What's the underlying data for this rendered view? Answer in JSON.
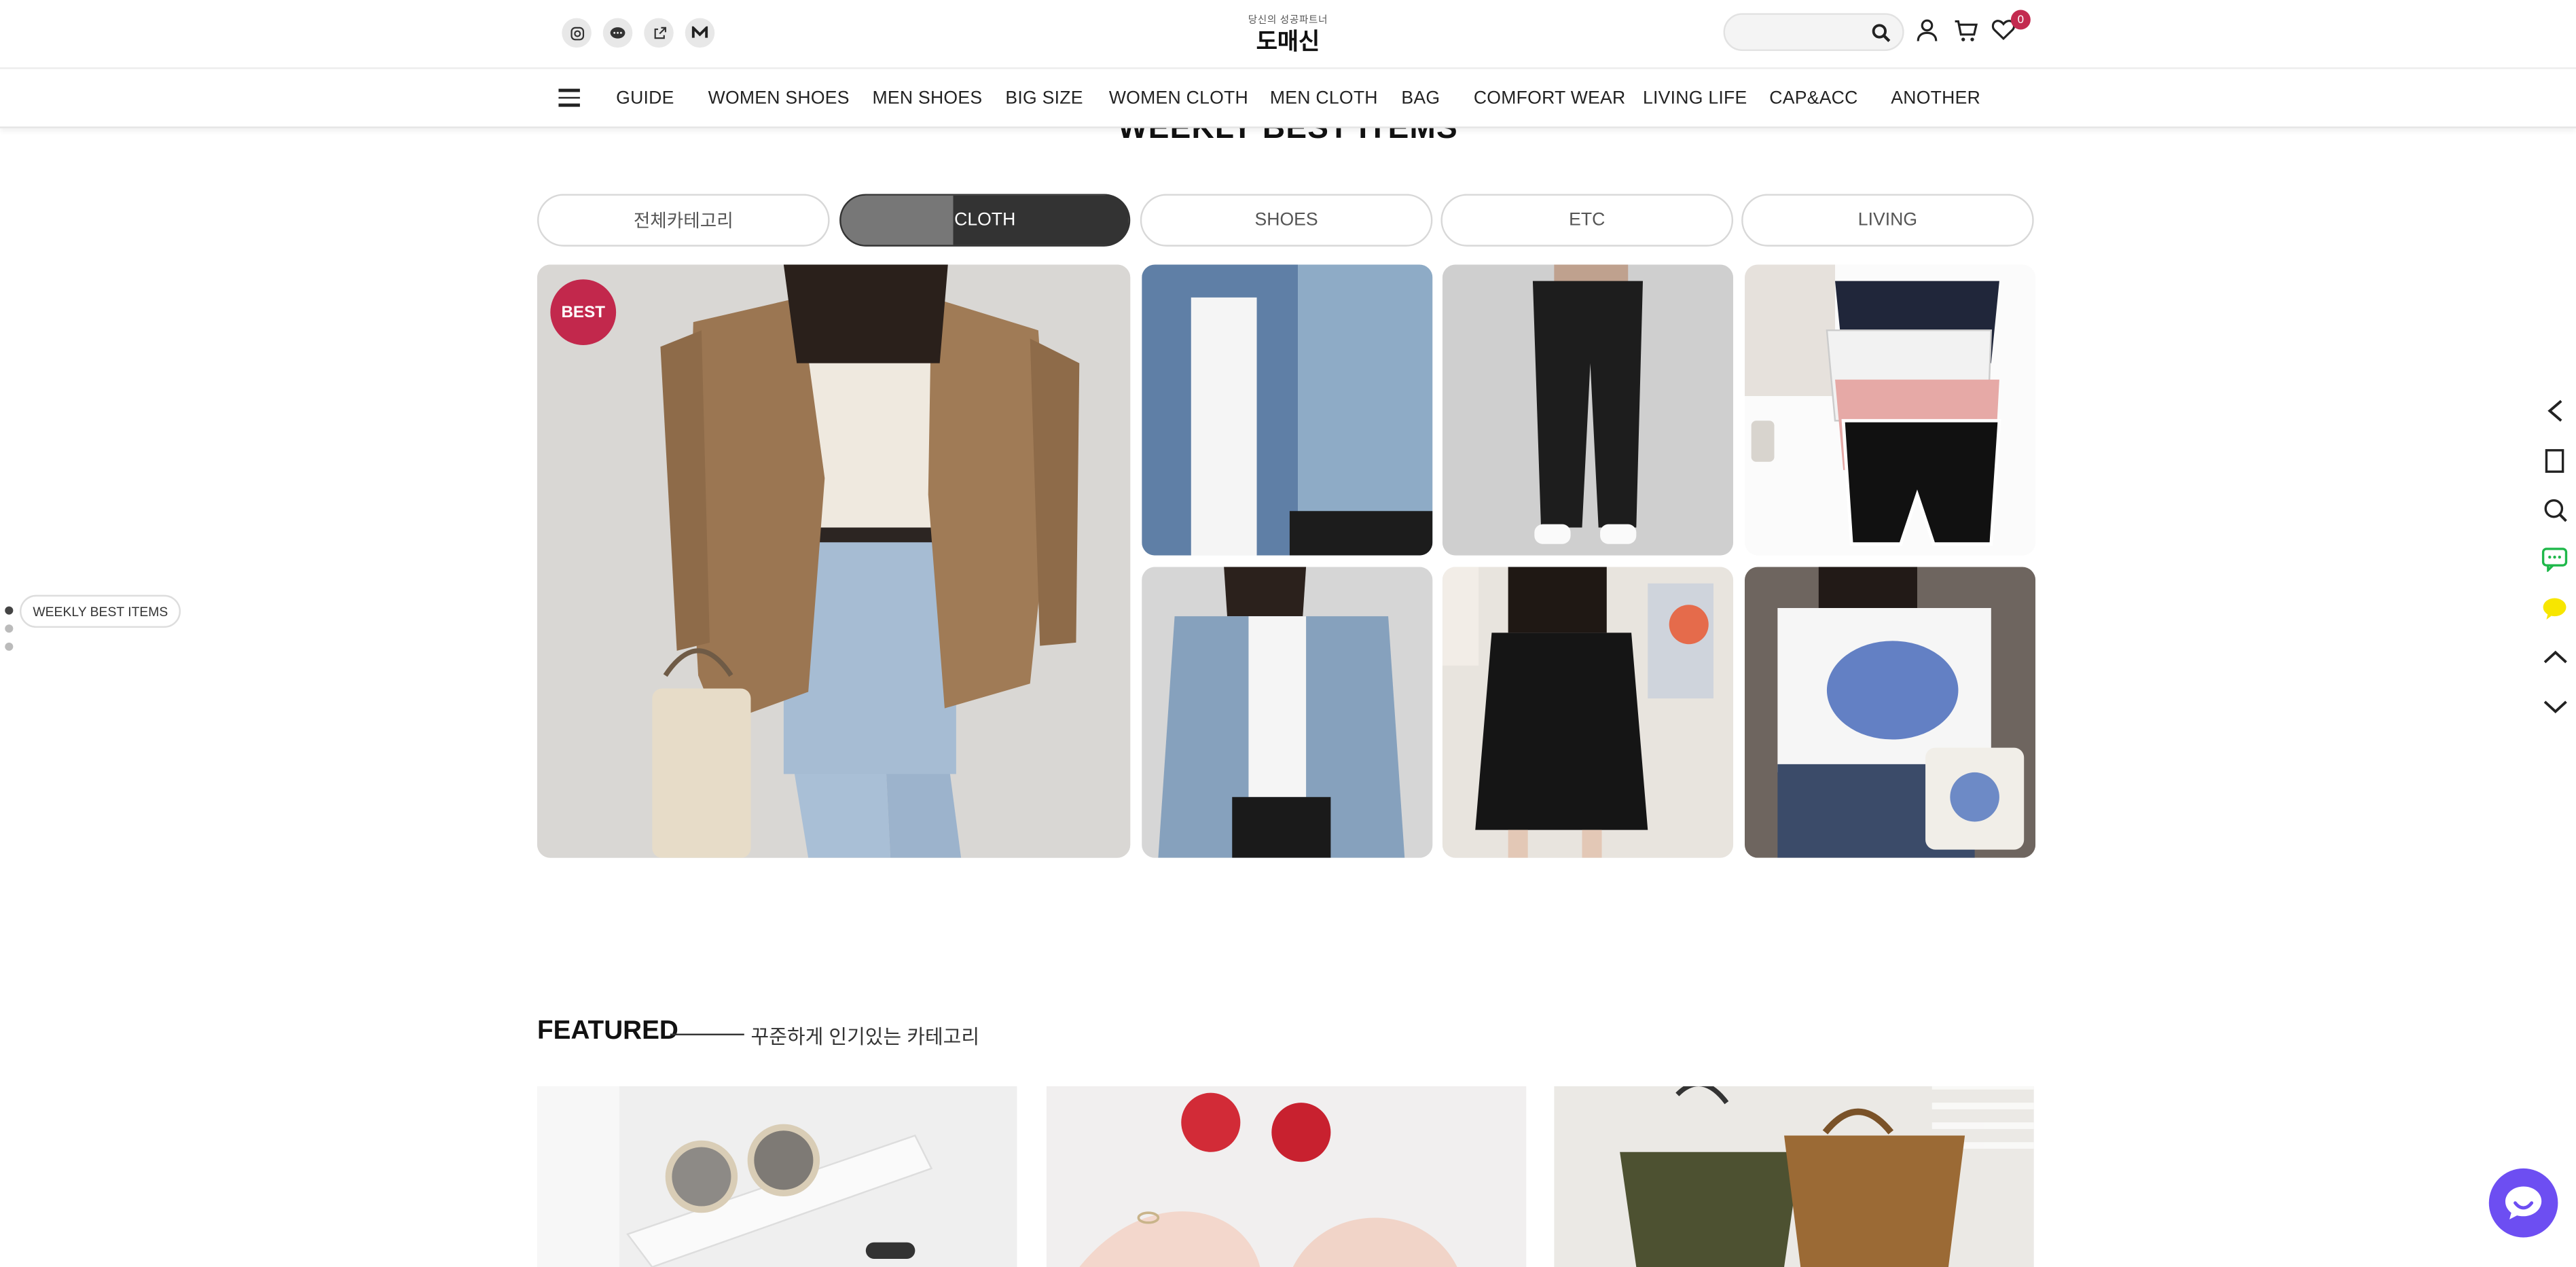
{
  "header": {
    "logo_tagline": "당신의 성공파트너",
    "logo_name": "도매신",
    "social_icons": [
      "instagram-icon",
      "talk-icon",
      "share-icon",
      "blog-icon"
    ],
    "search_placeholder": "",
    "cart_count": "0"
  },
  "nav": {
    "items": [
      "GUIDE",
      "WOMEN SHOES",
      "MEN SHOES",
      "BIG SIZE",
      "WOMEN CLOTH",
      "MEN CLOTH",
      "BAG",
      "COMFORT WEAR",
      "LIVING LIFE",
      "CAP&ACC",
      "ANOTHER"
    ]
  },
  "weekly": {
    "title": "WEEKLY BEST ITEMS",
    "tabs": [
      "전체카테고리",
      "CLOTH",
      "SHOES",
      "ETC",
      "LIVING"
    ],
    "active_tab": "CLOTH",
    "best_badge": "BEST",
    "side_label": "WEEKLY BEST ITEMS"
  },
  "featured": {
    "title": "FEATURED",
    "subtitle": "꾸준하게 인기있는 카테고리"
  },
  "colors": {
    "accent": "#c2284c",
    "chat": "#6d4ef2",
    "kakao": "#f7e600",
    "line": "#1fb84a"
  }
}
